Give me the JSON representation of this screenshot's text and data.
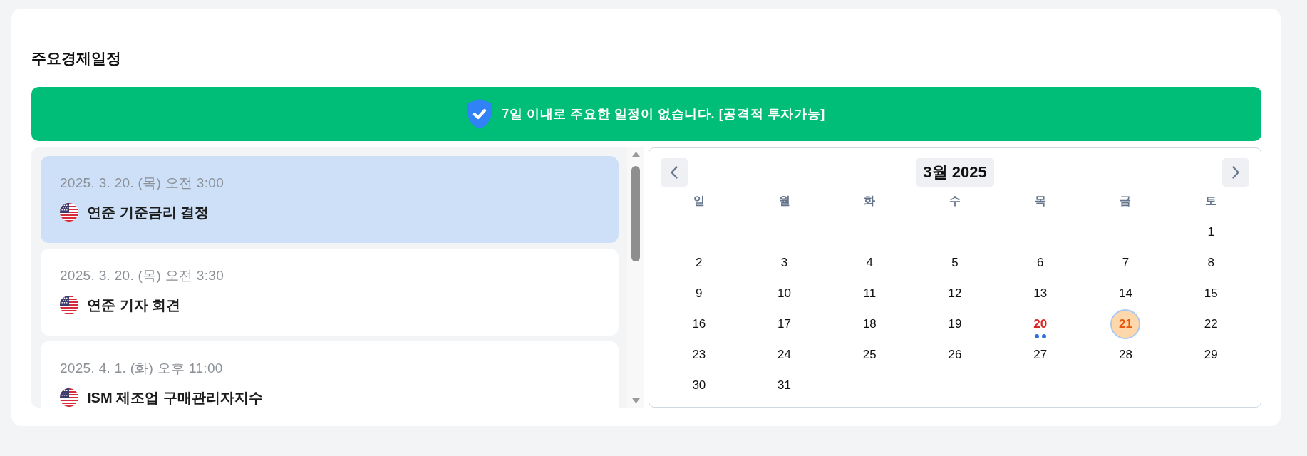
{
  "title": "주요경제일정",
  "banner": {
    "message": "7일 이내로 주요한 일정이 없습니다. [공격적 투자가능]"
  },
  "events": [
    {
      "datetime": "2025. 3. 20. (목) 오전 3:00",
      "title": "연준 기준금리 결정",
      "selected": true
    },
    {
      "datetime": "2025. 3. 20. (목) 오전 3:30",
      "title": "연준 기자 회견",
      "selected": false
    },
    {
      "datetime": "2025. 4. 1. (화) 오후 11:00",
      "title": "ISM 제조업 구매관리자지수",
      "selected": false
    }
  ],
  "calendar": {
    "month_label": "3월 2025",
    "weekdays": [
      "일",
      "월",
      "화",
      "수",
      "목",
      "금",
      "토"
    ],
    "weeks": [
      [
        {
          "label": "1",
          "selected": false,
          "today": false
        }
      ],
      [
        {
          "label": "2",
          "selected": false,
          "today": false
        },
        {
          "label": "3",
          "selected": false,
          "today": false
        },
        {
          "label": "4",
          "selected": false,
          "today": false
        },
        {
          "label": "5",
          "selected": false,
          "today": false
        },
        {
          "label": "6",
          "selected": false,
          "today": false
        },
        {
          "label": "7",
          "selected": false,
          "today": false
        },
        {
          "label": "8",
          "selected": false,
          "today": false
        }
      ],
      [
        {
          "label": "9",
          "selected": false,
          "today": false
        },
        {
          "label": "10",
          "selected": false,
          "today": false
        },
        {
          "label": "11",
          "selected": false,
          "today": false
        },
        {
          "label": "12",
          "selected": false,
          "today": false
        },
        {
          "label": "13",
          "selected": false,
          "today": false
        },
        {
          "label": "14",
          "selected": false,
          "today": false
        },
        {
          "label": "15",
          "selected": false,
          "today": false
        }
      ],
      [
        {
          "label": "16",
          "selected": false,
          "today": false
        },
        {
          "label": "17",
          "selected": false,
          "today": false
        },
        {
          "label": "18",
          "selected": false,
          "today": false
        },
        {
          "label": "19",
          "selected": false,
          "today": false
        },
        {
          "label": "20",
          "selected": true,
          "today": false,
          "event_dots": [
            {
              "color": "#2f6fe4"
            },
            {
              "color": "#2f6fe4"
            }
          ]
        },
        {
          "label": "21",
          "selected": false,
          "today": true
        },
        {
          "label": "22",
          "selected": false,
          "today": false
        }
      ],
      [
        {
          "label": "23",
          "selected": false,
          "today": false
        },
        {
          "label": "24",
          "selected": false,
          "today": false
        },
        {
          "label": "25",
          "selected": false,
          "today": false
        },
        {
          "label": "26",
          "selected": false,
          "today": false
        },
        {
          "label": "27",
          "selected": false,
          "today": false
        },
        {
          "label": "28",
          "selected": false,
          "today": false
        },
        {
          "label": "29",
          "selected": false,
          "today": false
        }
      ],
      [
        {
          "label": "30",
          "selected": false,
          "today": false
        },
        {
          "label": "31",
          "selected": false,
          "today": false
        }
      ]
    ]
  }
}
